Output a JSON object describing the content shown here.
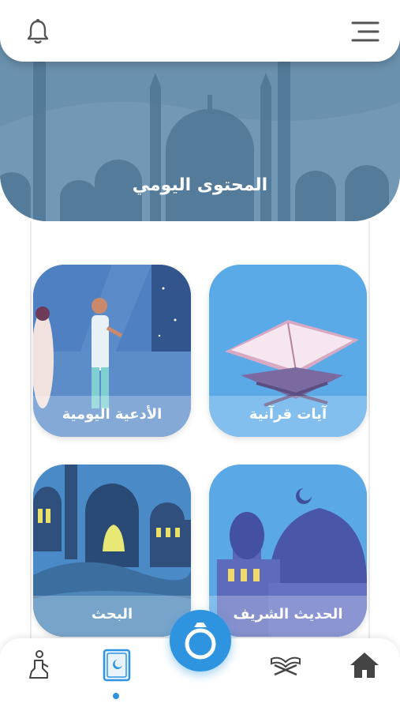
{
  "hero": {
    "title": "المحتوى اليومي"
  },
  "cards": [
    {
      "label": "آيات قرآنية"
    },
    {
      "label": "الأدعية اليومية"
    },
    {
      "label": "الحديث الشريف"
    },
    {
      "label": "البحث"
    }
  ],
  "bottom_nav": {
    "items": [
      "home-icon",
      "quran-stand-icon",
      "ring-icon",
      "quran-book-icon",
      "praying-person-icon"
    ],
    "active": "quran-book-icon"
  },
  "colors": {
    "accent": "#2e94e0",
    "hero": "#6a92b0",
    "card_blue": "#5aa9e6"
  }
}
